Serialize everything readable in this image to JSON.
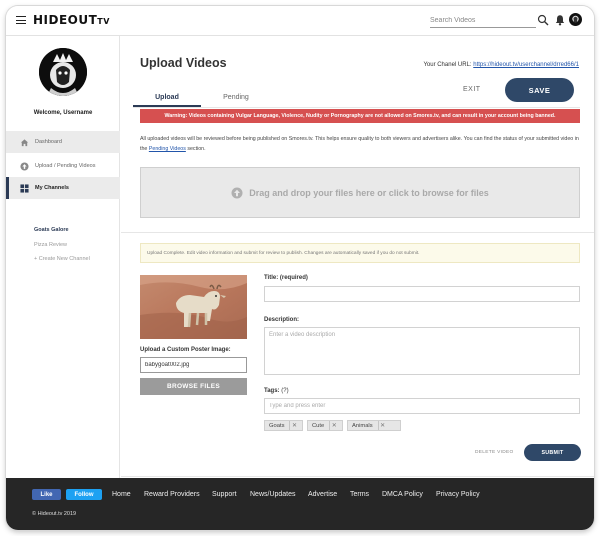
{
  "header": {
    "logo_main": "HIDEOUT",
    "logo_suffix": "TV",
    "search_placeholder": "Search Videos",
    "icons": [
      "menu-icon",
      "search-icon",
      "bell-icon",
      "avatar"
    ]
  },
  "sidebar": {
    "welcome": "Welcome, Username",
    "items": [
      {
        "label": "Dashboard",
        "icon": "home-icon"
      },
      {
        "label": "Upload / Pending Videos",
        "icon": "upload-icon"
      },
      {
        "label": "My Channels",
        "icon": "grid-icon"
      }
    ],
    "channels": [
      "Goats Galore",
      "Pizza Review",
      "+ Create New Channel"
    ]
  },
  "main": {
    "title": "Upload Videos",
    "channel_url_label": "Your Chanel URL:",
    "channel_url": "https://hideout.tv/userchannel/drred66/1",
    "tabs": [
      "Upload",
      "Pending"
    ],
    "active_tab": "Upload",
    "exit_label": "EXIT",
    "save_label": "SAVE",
    "warning": "Warning: Videos containing Vulgar Language, Violence, Nudity or Pornography are not allowed on Smores.tv, and can result in your account being banned.",
    "review_text_1": "All uploaded videos will be reviewed before being published on Smores.tv. This helps ensure quality to both viewers and advertisers alike. You can find the status of your submitted video in the ",
    "review_link": "Pending Videos",
    "review_text_2": " section.",
    "dropzone_text": "Drag and drop your files here or click to browse for files",
    "notice": "Upload Complete. Edit video information and submit for review to publish. Changes are automatically saved if you do not submit.",
    "poster_label": "Upload a Custom Poster Image:",
    "poster_filename": "babygoat002.jpg",
    "browse_label": "BROWSE FILES",
    "title_label": "Title: (required)",
    "title_value": "",
    "description_label": "Description:",
    "description_placeholder": "Enter a video description",
    "tags_label": "Tags:",
    "tags_help": "(?)",
    "tags_placeholder": "Type and press enter",
    "tags": [
      "Goats",
      "Cute",
      "Animals"
    ],
    "delete_label": "DELETE VIDEO",
    "submit_label": "SUBMIT"
  },
  "footer": {
    "like_label": "Like",
    "follow_label": "Follow",
    "links": [
      "Home",
      "Reward Providers",
      "Support",
      "News/Updates",
      "Advertise",
      "Terms",
      "DMCA Policy",
      "Privacy Policy"
    ],
    "copyright": "© Hideout.tv 2019"
  },
  "colors": {
    "accent": "#2f4868",
    "warning": "#d65050",
    "footer": "#262626"
  }
}
